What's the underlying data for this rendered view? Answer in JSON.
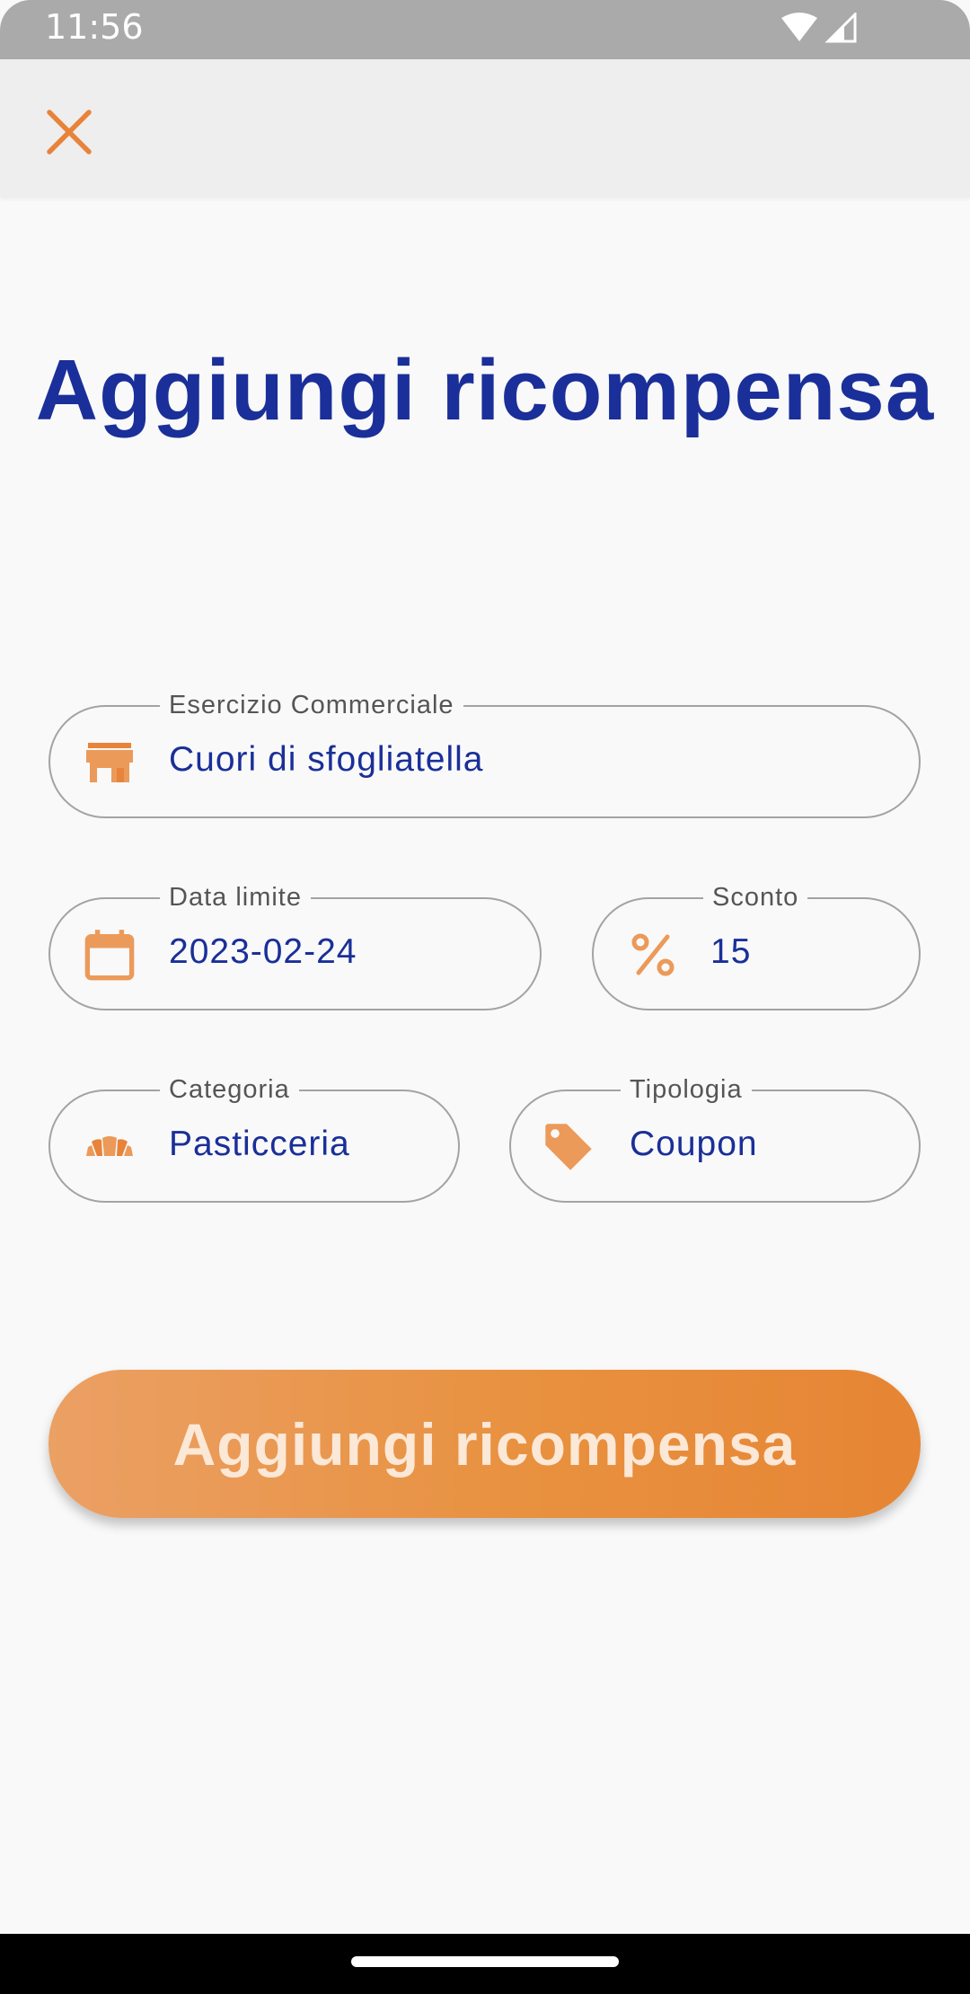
{
  "status_bar": {
    "time": "11:56"
  },
  "app_bar": {
    "close_icon": "close-icon"
  },
  "page": {
    "title": "Aggiungi ricompensa"
  },
  "form": {
    "business": {
      "label": "Esercizio Commerciale",
      "value": "Cuori di sfogliatella",
      "icon": "store-icon"
    },
    "deadline": {
      "label": "Data limite",
      "value": "2023-02-24",
      "icon": "calendar-icon"
    },
    "discount": {
      "label": "Sconto",
      "value": "15",
      "icon": "percent-icon"
    },
    "category": {
      "label": "Categoria",
      "value": "Pasticceria",
      "icon": "croissant-icon"
    },
    "type": {
      "label": "Tipologia",
      "value": "Coupon",
      "icon": "tag-icon"
    }
  },
  "submit": {
    "label": "Aggiungi ricompensa"
  },
  "colors": {
    "primary": "#1a2f99",
    "accent": "#e8833a",
    "border": "#a3a3a3",
    "background": "#f9f9f9"
  }
}
